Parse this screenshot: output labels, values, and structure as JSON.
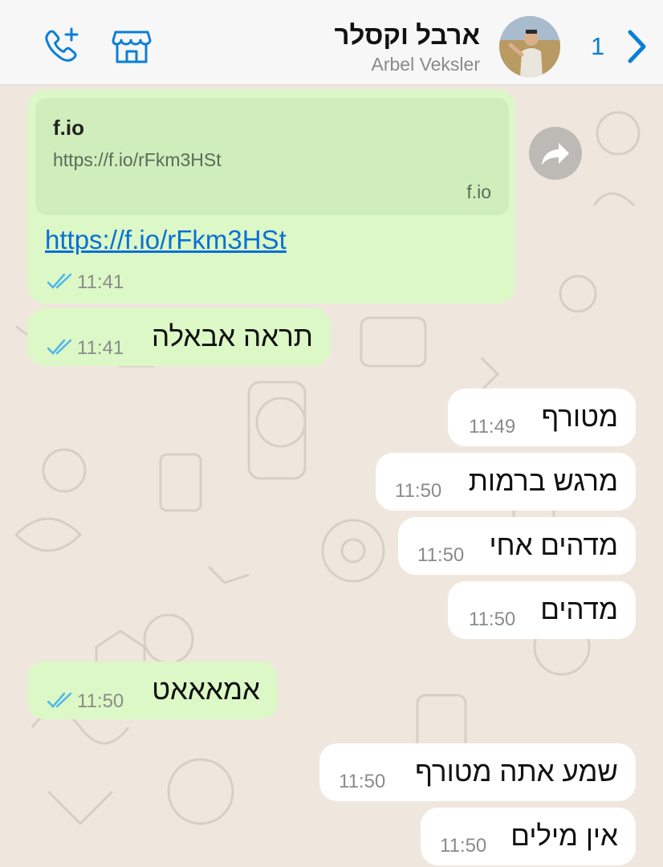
{
  "header": {
    "contact_name": "ארבל וקסלר",
    "contact_subtitle": "Arbel Veksler",
    "unread_count": "1",
    "colors": {
      "accent": "#0b7fd6",
      "background": "#f7f7f7"
    }
  },
  "link_message": {
    "preview_title": "f.io",
    "preview_url": "https://f.io/rFkm3HSt",
    "preview_domain": "f.io",
    "link": "https://f.io/rFkm3HSt",
    "time": "11:41"
  },
  "messages": [
    {
      "text": "תראה אבאלה",
      "time": "11:41",
      "direction": "outgoing"
    },
    {
      "text": "מטורף",
      "time": "11:49",
      "direction": "incoming"
    },
    {
      "text": "מרגש ברמות",
      "time": "11:50",
      "direction": "incoming"
    },
    {
      "text": "מדהים אחי",
      "time": "11:50",
      "direction": "incoming"
    },
    {
      "text": "מדהים",
      "time": "11:50",
      "direction": "incoming"
    },
    {
      "text": "אמאאאט",
      "time": "11:50",
      "direction": "outgoing"
    },
    {
      "text": "שמע אתה מטורף",
      "time": "11:50",
      "direction": "incoming"
    },
    {
      "text": "אין מילים",
      "time": "11:50",
      "direction": "incoming"
    }
  ],
  "colors": {
    "outgoing_bubble": "#dcf8c6",
    "incoming_bubble": "#ffffff",
    "read_ticks": "#4fb6ec",
    "wallpaper": "#efe7de"
  },
  "icons": [
    "call-add-icon",
    "shop-icon",
    "chevron-right-icon",
    "forward-icon",
    "double-check-icon"
  ]
}
